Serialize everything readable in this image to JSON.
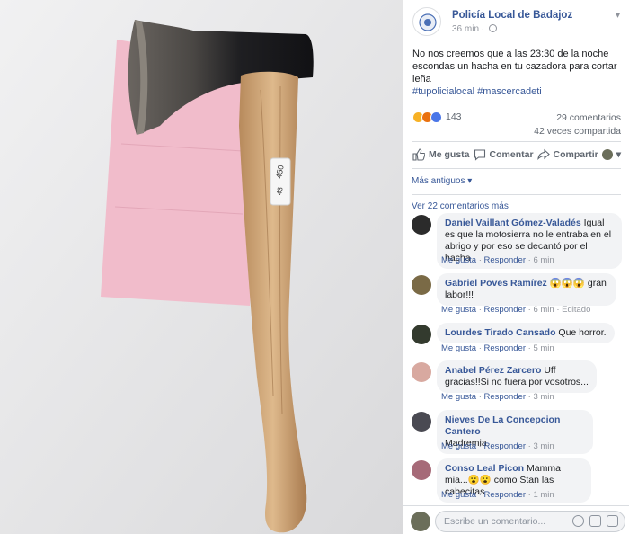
{
  "post": {
    "page_name": "Policía Local de Badajoz",
    "time": "36 min",
    "text": "No nos creemos que a las 23:30 de la noche escondas un hacha en tu cazadora para cortar leña",
    "hashtags": "#tupolicialocal #mascercadeti",
    "photo_label_1": "450",
    "photo_label_2": "43"
  },
  "stats": {
    "reaction_count": "143",
    "comments_count": "29 comentarios",
    "shares_count": "42 veces compartida",
    "reaction_icons": [
      "wow-icon",
      "angry-icon",
      "like-icon"
    ]
  },
  "actions": {
    "like": "Me gusta",
    "comment": "Comentar",
    "share": "Compartir"
  },
  "sort_label": "Más antiguos ▾",
  "more_comments": "Ver 22 comentarios más",
  "comments": [
    {
      "name": "Daniel Vaillant Gómez-Valadés",
      "text": "Igual es que la motosierra no le entraba en el abrigo y por eso se decantó por el hacha",
      "like": "Me gusta",
      "reply": "Responder",
      "time": "6 min",
      "extra": ""
    },
    {
      "name": "Gabriel Poves Ramírez",
      "text": "😱😱😱 gran labor!!!",
      "like": "Me gusta",
      "reply": "Responder",
      "time": "6 min",
      "extra": "Editado"
    },
    {
      "name": "Lourdes Tirado Cansado",
      "text": "Que horror.",
      "like": "Me gusta",
      "reply": "Responder",
      "time": "5 min",
      "extra": ""
    },
    {
      "name": "Anabel Pérez Zarcero",
      "text": "Uff gracias!!Si no fuera por vosotros...",
      "like": "Me gusta",
      "reply": "Responder",
      "time": "3 min",
      "extra": ""
    },
    {
      "name": "Nieves De La Concepcion Cantero",
      "text": "Madremia",
      "like": "Me gusta",
      "reply": "Responder",
      "time": "3 min",
      "extra": ""
    },
    {
      "name": "Conso Leal Picon",
      "text": "Mamma mia...😮😮 como Stan las cabecitas",
      "like": "Me gusta",
      "reply": "Responder",
      "time": "1 min",
      "extra": ""
    }
  ],
  "composer": {
    "placeholder": "Escribe un comentario..."
  },
  "colors": {
    "link": "#385898",
    "muted": "#90949c",
    "bubble": "#f2f3f5"
  }
}
